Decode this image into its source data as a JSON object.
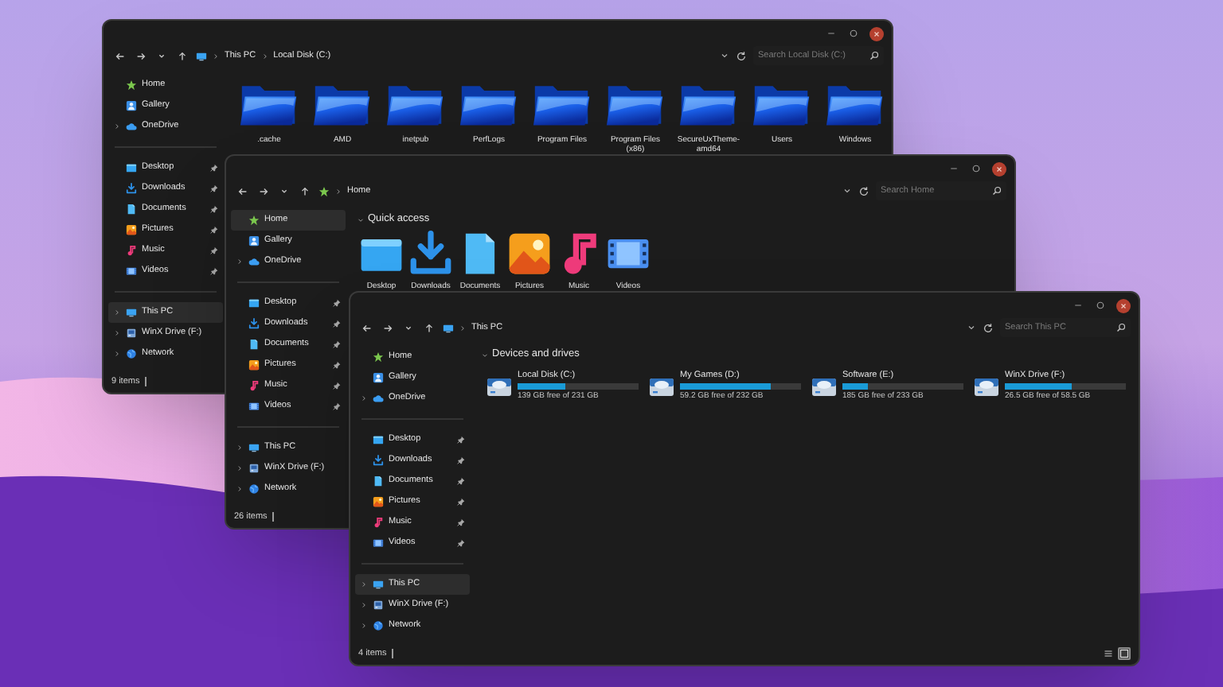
{
  "windows": [
    {
      "address": {
        "kind": "pc",
        "crumbs": [
          "This PC",
          "Local Disk (C:)"
        ]
      },
      "search": {
        "placeholder": "Search Local Disk (C:)"
      },
      "sidebar": {
        "groups": [
          [
            {
              "kind": "home",
              "label": "Home",
              "selected": false,
              "expandable": false,
              "pinned": false
            },
            {
              "kind": "gallery",
              "label": "Gallery",
              "selected": false,
              "expandable": false,
              "pinned": false
            },
            {
              "kind": "cloud",
              "label": "OneDrive",
              "selected": false,
              "expandable": true,
              "pinned": false
            }
          ],
          [
            {
              "kind": "desktop",
              "label": "Desktop",
              "selected": false,
              "expandable": false,
              "pinned": true
            },
            {
              "kind": "downloads",
              "label": "Downloads",
              "selected": false,
              "expandable": false,
              "pinned": true
            },
            {
              "kind": "documents",
              "label": "Documents",
              "selected": false,
              "expandable": false,
              "pinned": true
            },
            {
              "kind": "pictures",
              "label": "Pictures",
              "selected": false,
              "expandable": false,
              "pinned": true
            },
            {
              "kind": "music",
              "label": "Music",
              "selected": false,
              "expandable": false,
              "pinned": true
            },
            {
              "kind": "videos",
              "label": "Videos",
              "selected": false,
              "expandable": false,
              "pinned": true
            }
          ],
          [
            {
              "kind": "pc",
              "label": "This PC",
              "selected": true,
              "expandable": true,
              "pinned": false
            },
            {
              "kind": "drive",
              "label": "WinX Drive (F:)",
              "selected": false,
              "expandable": true,
              "pinned": false
            },
            {
              "kind": "network",
              "label": "Network",
              "selected": false,
              "expandable": true,
              "pinned": false
            }
          ]
        ]
      },
      "content": {
        "kind": "folders",
        "items": [
          {
            "label": ".cache"
          },
          {
            "label": "AMD"
          },
          {
            "label": "inetpub"
          },
          {
            "label": "PerfLogs"
          },
          {
            "label": "Program Files"
          },
          {
            "label": "Program Files (x86)"
          },
          {
            "label": "SecureUxTheme-amd64"
          },
          {
            "label": "Users"
          },
          {
            "label": "Windows"
          }
        ]
      },
      "status_bar": {
        "text": "9 items"
      }
    },
    {
      "address": {
        "kind": "home",
        "crumbs": [
          "Home"
        ]
      },
      "search": {
        "placeholder": "Search Home"
      },
      "sidebar": {
        "groups": [
          [
            {
              "kind": "home",
              "label": "Home",
              "selected": true,
              "expandable": false,
              "pinned": false
            },
            {
              "kind": "gallery",
              "label": "Gallery",
              "selected": false,
              "expandable": false,
              "pinned": false
            },
            {
              "kind": "cloud",
              "label": "OneDrive",
              "selected": false,
              "expandable": true,
              "pinned": false
            }
          ],
          [
            {
              "kind": "desktop",
              "label": "Desktop",
              "selected": false,
              "expandable": false,
              "pinned": true
            },
            {
              "kind": "downloads",
              "label": "Downloads",
              "selected": false,
              "expandable": false,
              "pinned": true
            },
            {
              "kind": "documents",
              "label": "Documents",
              "selected": false,
              "expandable": false,
              "pinned": true
            },
            {
              "kind": "pictures",
              "label": "Pictures",
              "selected": false,
              "expandable": false,
              "pinned": true
            },
            {
              "kind": "music",
              "label": "Music",
              "selected": false,
              "expandable": false,
              "pinned": true
            },
            {
              "kind": "videos",
              "label": "Videos",
              "selected": false,
              "expandable": false,
              "pinned": true
            }
          ],
          [
            {
              "kind": "pc",
              "label": "This PC",
              "selected": false,
              "expandable": true,
              "pinned": false
            },
            {
              "kind": "drive",
              "label": "WinX Drive (F:)",
              "selected": false,
              "expandable": true,
              "pinned": false
            },
            {
              "kind": "network",
              "label": "Network",
              "selected": false,
              "expandable": true,
              "pinned": false
            }
          ]
        ]
      },
      "content": {
        "kind": "quick_access",
        "title": "Quick access",
        "items": [
          {
            "kind": "desktop",
            "label": "Desktop"
          },
          {
            "kind": "downloads",
            "label": "Downloads"
          },
          {
            "kind": "documents",
            "label": "Documents"
          },
          {
            "kind": "pictures",
            "label": "Pictures"
          },
          {
            "kind": "music",
            "label": "Music"
          },
          {
            "kind": "videos",
            "label": "Videos"
          }
        ]
      },
      "status_bar": {
        "text": "26 items"
      }
    },
    {
      "address": {
        "kind": "pc",
        "crumbs": [
          "This PC"
        ]
      },
      "search": {
        "placeholder": "Search This PC"
      },
      "sidebar": {
        "groups": [
          [
            {
              "kind": "home",
              "label": "Home",
              "selected": false,
              "expandable": false,
              "pinned": false
            },
            {
              "kind": "gallery",
              "label": "Gallery",
              "selected": false,
              "expandable": false,
              "pinned": false
            },
            {
              "kind": "cloud",
              "label": "OneDrive",
              "selected": false,
              "expandable": true,
              "pinned": false
            }
          ],
          [
            {
              "kind": "desktop",
              "label": "Desktop",
              "selected": false,
              "expandable": false,
              "pinned": true
            },
            {
              "kind": "downloads",
              "label": "Downloads",
              "selected": false,
              "expandable": false,
              "pinned": true
            },
            {
              "kind": "documents",
              "label": "Documents",
              "selected": false,
              "expandable": false,
              "pinned": true
            },
            {
              "kind": "pictures",
              "label": "Pictures",
              "selected": false,
              "expandable": false,
              "pinned": true
            },
            {
              "kind": "music",
              "label": "Music",
              "selected": false,
              "expandable": false,
              "pinned": true
            },
            {
              "kind": "videos",
              "label": "Videos",
              "selected": false,
              "expandable": false,
              "pinned": true
            }
          ],
          [
            {
              "kind": "pc",
              "label": "This PC",
              "selected": true,
              "expandable": true,
              "pinned": false
            },
            {
              "kind": "drive",
              "label": "WinX Drive (F:)",
              "selected": false,
              "expandable": true,
              "pinned": false
            },
            {
              "kind": "network",
              "label": "Network",
              "selected": false,
              "expandable": true,
              "pinned": false
            }
          ]
        ]
      },
      "content": {
        "kind": "drives",
        "title": "Devices and drives",
        "items": [
          {
            "label": "Local Disk (C:)",
            "level": 0.4,
            "free": "139 GB free of 231 GB"
          },
          {
            "label": "My Games (D:)",
            "level": 0.745,
            "free": "59.2 GB free of 232 GB"
          },
          {
            "label": "Software (E:)",
            "level": 0.206,
            "free": "185 GB free of 233 GB"
          },
          {
            "label": "WinX Drive (F:)",
            "level": 0.547,
            "free": "26.5 GB free of 58.5 GB"
          }
        ]
      },
      "status_bar": {
        "text": "4 items",
        "view_buttons": [
          {
            "kind": "details",
            "selected": false
          },
          {
            "kind": "tiles",
            "selected": true
          }
        ]
      }
    }
  ]
}
